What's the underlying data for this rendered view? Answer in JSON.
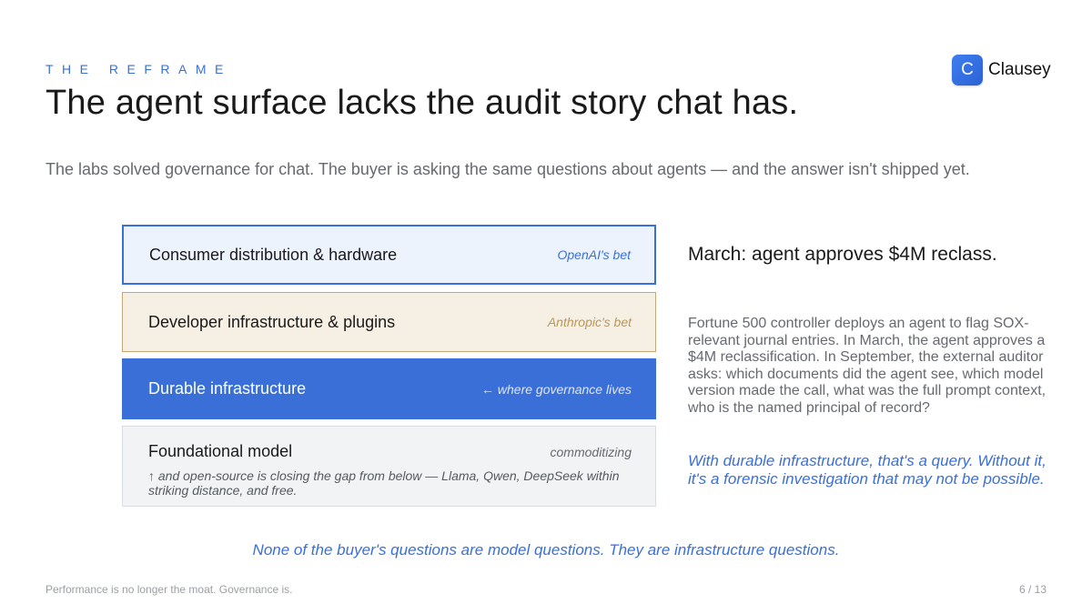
{
  "header": {
    "eyebrow": "THE REFRAME",
    "title": "The agent surface lacks the audit story chat has.",
    "subtitle": "The labs solved governance for chat. The buyer is asking the same questions about agents — and the answer isn't shipped yet."
  },
  "brand": {
    "logo_letter": "C",
    "name": "Clausey",
    "accent_color": "#3a6fd8"
  },
  "stack": {
    "layers": [
      {
        "name": "Consumer distribution & hardware",
        "tag": "OpenAI's bet"
      },
      {
        "name": "Developer infrastructure & plugins",
        "tag": "Anthropic's bet"
      },
      {
        "name": "Durable infrastructure",
        "tag": "← where governance lives"
      },
      {
        "name": "Foundational model",
        "tag": "commoditizing",
        "note": "↑ and open-source is closing the gap from below — Llama, Qwen, DeepSeek within striking distance, and free."
      }
    ]
  },
  "side": {
    "heading": "March: agent approves $4M reclass.",
    "body": "Fortune 500 controller deploys an agent to flag SOX-relevant journal entries. In March, the agent approves a $4M reclassification. In September, the external auditor asks: which documents did the agent see, which model version made the call, what was the full prompt context, who is the named principal of record?",
    "quote": "With durable infrastructure, that's a query. Without it, it's a forensic investigation that may not be possible."
  },
  "conclusion": "None of the buyer's questions are model questions. They are infrastructure questions.",
  "footer": {
    "tagline": "Performance is no longer the moat. Governance is.",
    "page": "6 / 13"
  }
}
